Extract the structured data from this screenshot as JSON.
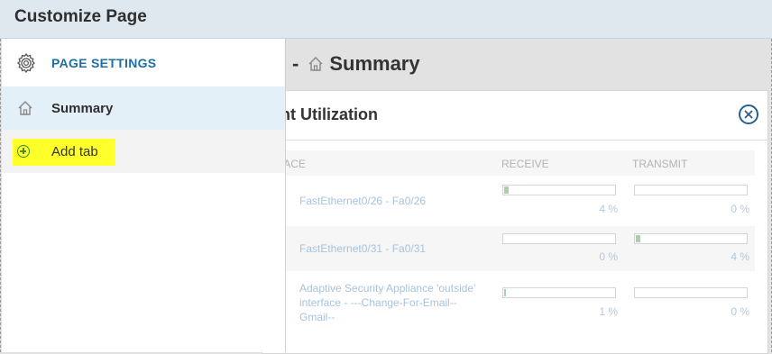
{
  "header": {
    "title": "Customize Page"
  },
  "background": {
    "heading_prefix": "-",
    "heading": "Summary",
    "widget": {
      "title": "ent Utilization",
      "columns": {
        "interface": "RFACE",
        "receive": "RECEIVE",
        "transmit": "TRANSMIT"
      },
      "rows": [
        {
          "interface": "FastEthernet0/26 - Fa0/26",
          "receive_pct": "4 %",
          "transmit_pct": "0 %",
          "receive_value": 4,
          "transmit_value": 0
        },
        {
          "interface": "FastEthernet0/31 - Fa0/31",
          "receive_pct": "0 %",
          "transmit_pct": "4 %",
          "receive_value": 0,
          "transmit_value": 4
        },
        {
          "interface": "Adaptive Security Appliance 'outside' interface - ---Change-For-Email--Gmail--",
          "receive_pct": "1 %",
          "transmit_pct": "0 %",
          "receive_value": 1,
          "transmit_value": 0
        }
      ]
    }
  },
  "sidebar": {
    "header_label": "PAGE SETTINGS",
    "items": [
      {
        "label": "Summary",
        "icon": "home-icon",
        "active": true
      },
      {
        "label": "Add tab",
        "icon": "plus-circle-icon",
        "highlighted": true
      }
    ]
  },
  "colors": {
    "accent": "#1f6fa3",
    "highlight": "#ffff2a",
    "active_bg": "#e4f0f7",
    "bar_fill": "#a9d0a9",
    "link_text": "#a7c3de"
  }
}
